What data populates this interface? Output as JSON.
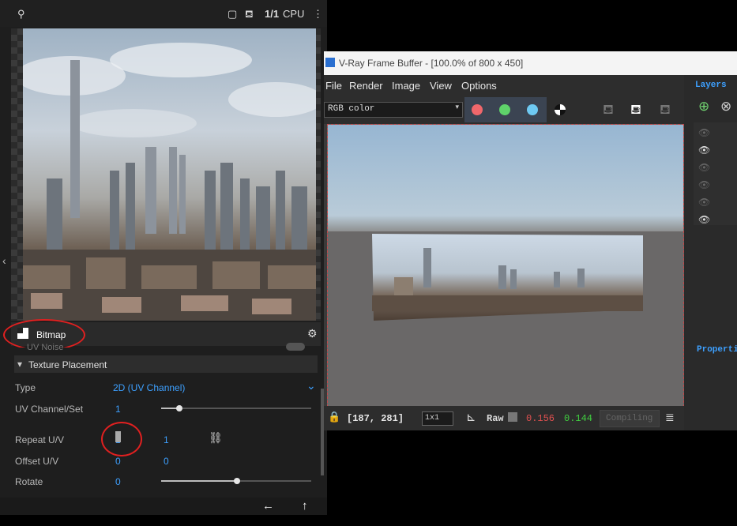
{
  "left_panel": {
    "toolbar": {
      "gpu_label": "CPU",
      "ratio_label": "1/1"
    },
    "bitmap": {
      "label": "Bitmap",
      "cut_label": "UV Noise"
    },
    "section": {
      "title": "Texture Placement"
    },
    "params": [
      {
        "label": "Type",
        "value": "2D (UV Channel)"
      },
      {
        "label": "UV Channel/Set",
        "value": "1"
      },
      {
        "label": "Repeat U/V",
        "value_u": "1",
        "value_v": "1"
      },
      {
        "label": "Offset U/V",
        "value_u": "0",
        "value_v": "0"
      },
      {
        "label": "Rotate",
        "value": "0"
      }
    ]
  },
  "vfb": {
    "title": "V-Ray Frame Buffer - [100.0% of 800 x 450]",
    "menu": [
      "File",
      "Render",
      "Image",
      "View",
      "Options"
    ],
    "channel": "RGB color",
    "status": {
      "coords": "[187, 281]",
      "sample_size": "1x1",
      "raw_label": "Raw",
      "val_r": "0.156",
      "val_g": "0.144",
      "compare": "Compiling"
    },
    "layers_tab": "Layers",
    "properties_tab": "Properties"
  },
  "colors": {
    "accent_blue": "#3da0ff",
    "annotation_red": "#e02020",
    "red_value": "#e05050",
    "green_value": "#40d040"
  },
  "icons": [
    "link-icon",
    "chevron-down-icon",
    "settings-icon",
    "back-arrow-icon",
    "up-arrow-icon",
    "teapot-icon",
    "eye-icon",
    "lock-icon",
    "curve-icon",
    "more-icon",
    "checker-icon"
  ]
}
